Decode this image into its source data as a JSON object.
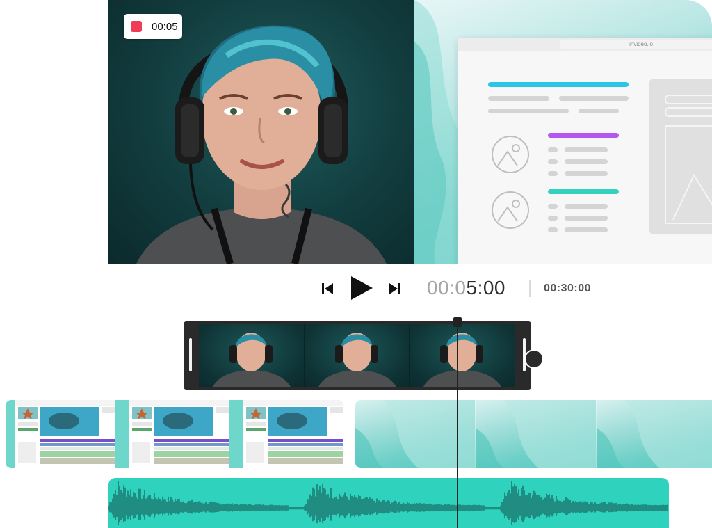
{
  "recording": {
    "indicator_color": "#ef3b55",
    "elapsed": "00:05"
  },
  "browser": {
    "url": "invideo.io",
    "accent_colors": [
      "#29c6e8",
      "#b459f0",
      "#35d1bf"
    ]
  },
  "transport": {
    "prev_icon": "skip-back-icon",
    "play_icon": "play-icon",
    "next_icon": "skip-forward-icon",
    "current_time_dim": "00:0",
    "current_time_main": "5:00",
    "total_time": "00:30:00"
  },
  "tracks": {
    "video_clip_frames": 3,
    "screen_clip_thumbs": 3,
    "background_clip_thumbs": 3,
    "audio_color": "#2ed2bd",
    "waveform_color": "#175f5a"
  }
}
